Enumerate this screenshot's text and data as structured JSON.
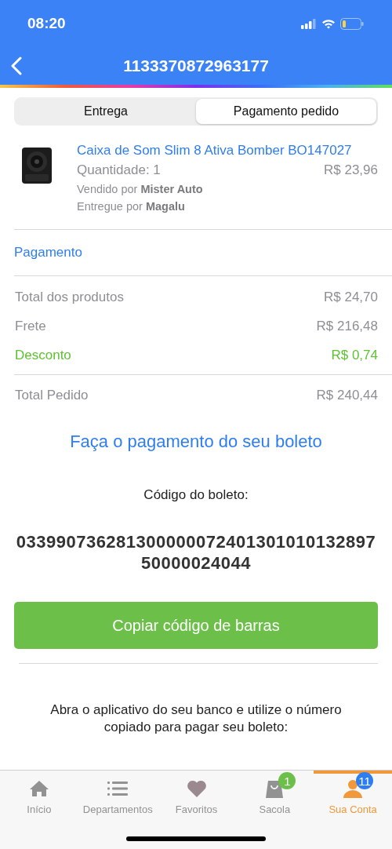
{
  "status_bar": {
    "time": "08:20"
  },
  "header": {
    "title": "1133370872963177"
  },
  "segments": [
    {
      "label": "Entrega",
      "selected": false
    },
    {
      "label": "Pagamento pedido",
      "selected": true
    }
  ],
  "product": {
    "name": "Caixa de Som Slim 8 Ativa Bomber BO147027",
    "quantity": "Quantidade: 1",
    "price": "R$ 23,96",
    "seller": "Vendido por **Mister Auto**",
    "delivery": "Entregue por **Magalu**"
  },
  "payment": {
    "heading": "Pagamento",
    "rows": [
      {
        "label": "Total dos produtos",
        "value": "R$ 24,70",
        "color": "#8e8e93"
      },
      {
        "label": "Frete",
        "value": "R$ 216,48",
        "color": "#8e8e93"
      },
      {
        "label": "Desconto",
        "value": "R$ 0,74",
        "color": "#5ec232"
      }
    ],
    "total": {
      "label": "Total Pedido",
      "value": "R$ 240,44"
    }
  },
  "boleto": {
    "heading": "Faça o pagamento do seu boleto",
    "code_label": "Código do boleto:",
    "code": "03399073628130000007240130101013289750000024044",
    "button": "Copiar código de barras",
    "instructions": "Abra o aplicativo do seu banco e utilize o número copiado para pagar seu boleto:"
  },
  "tab_bar": [
    {
      "kind": "home",
      "label": "Início",
      "selected": false
    },
    {
      "kind": "list",
      "label": "Departamentos",
      "selected": false
    },
    {
      "kind": "heart",
      "label": "Favoritos",
      "selected": false
    },
    {
      "kind": "bag",
      "label": "Sacola",
      "selected": false,
      "badge": "1",
      "color": "#6cc04a"
    },
    {
      "kind": "user",
      "label": "Sua Conta",
      "selected": true,
      "badge": "11",
      "color": "#2f7ef0"
    }
  ]
}
